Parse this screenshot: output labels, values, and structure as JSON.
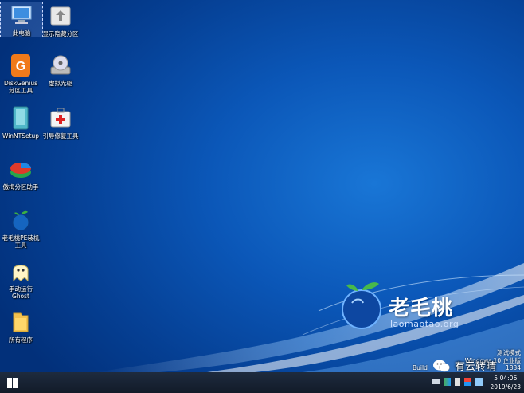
{
  "desktop_icons": [
    {
      "name": "this-pc",
      "label": "此电脑",
      "icon": "computer-icon"
    },
    {
      "name": "show-hidden-partition",
      "label": "显示隐藏分区",
      "icon": "partition-icon"
    },
    {
      "name": "diskgenius",
      "label": "DiskGenius\n分区工具",
      "icon": "diskgenius-icon"
    },
    {
      "name": "virtual-cdrom",
      "label": "虚拟光驱",
      "icon": "cdrom-icon"
    },
    {
      "name": "winntsetup",
      "label": "WinNTSetup",
      "icon": "winntsetup-icon"
    },
    {
      "name": "boot-repair",
      "label": "引导修复工具",
      "icon": "first-aid-icon"
    },
    {
      "name": "partition-assistant",
      "label": "傲梅分区助手",
      "icon": "partition-assistant-icon"
    },
    {
      "name": "pe-installer",
      "label": "老毛桃PE装机\n工具",
      "icon": "peach-icon"
    },
    {
      "name": "manual-ghost",
      "label": "手动运行\nGhost",
      "icon": "ghost-icon"
    },
    {
      "name": "all-programs",
      "label": "所有程序",
      "icon": "folder-icon"
    }
  ],
  "brand": {
    "name_cn": "老毛桃",
    "url": "laomaotao.org"
  },
  "watermark": {
    "line1": "测试模式",
    "line2": "Windows 10 企业版",
    "line3_prefix": "Build",
    "line3_suffix": "1834"
  },
  "wechat_overlay": {
    "text": "有云转晴"
  },
  "clock": {
    "time": "5:04:06",
    "date": "2019/6/23"
  },
  "colors": {
    "accent": "#0b57b8",
    "taskbar": "#17202f"
  }
}
